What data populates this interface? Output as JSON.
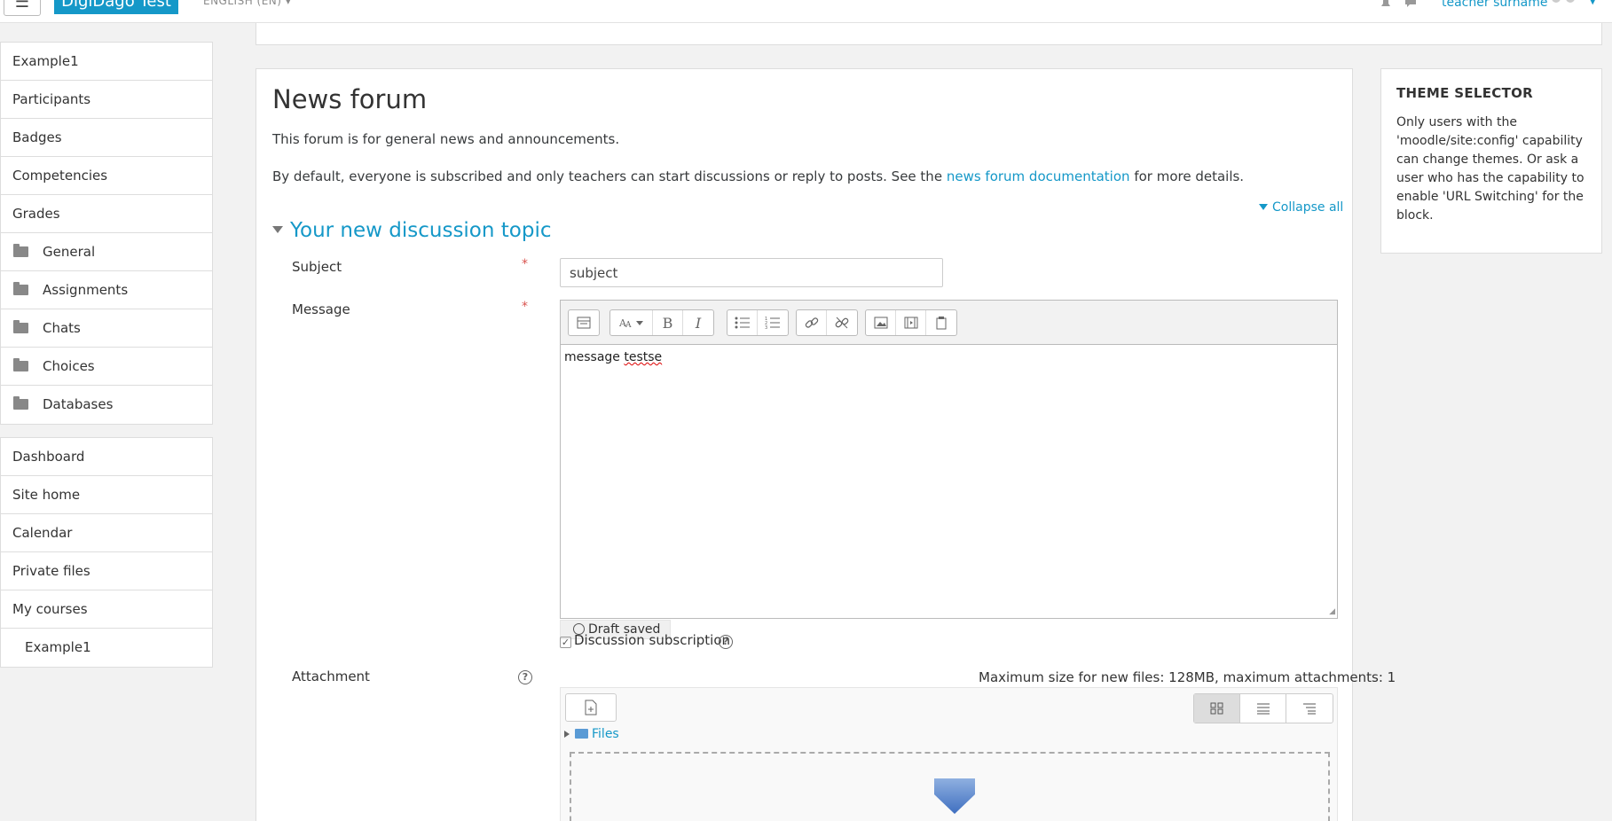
{
  "navbar": {
    "toggle_icon": "☰",
    "brand": "DigiDago Test",
    "language": "ENGLISH (EN)",
    "user_name": "teacher surname"
  },
  "sidebar": {
    "course_items": [
      {
        "label": "Example1",
        "type": "link"
      },
      {
        "label": "Participants",
        "type": "link"
      },
      {
        "label": "Badges",
        "type": "link"
      },
      {
        "label": "Competencies",
        "type": "link"
      },
      {
        "label": "Grades",
        "type": "link"
      },
      {
        "label": "General",
        "type": "folder"
      },
      {
        "label": "Assignments",
        "type": "folder"
      },
      {
        "label": "Chats",
        "type": "folder"
      },
      {
        "label": "Choices",
        "type": "folder"
      },
      {
        "label": "Databases",
        "type": "folder"
      }
    ],
    "site_items": [
      {
        "label": "Dashboard"
      },
      {
        "label": "Site home"
      },
      {
        "label": "Calendar"
      },
      {
        "label": "Private files"
      },
      {
        "label": "My courses"
      },
      {
        "label": "Example1"
      }
    ]
  },
  "main": {
    "title": "News forum",
    "intro": "This forum is for general news and announcements.",
    "intro2_before": "By default, everyone is subscribed and only teachers can start discussions or reply to posts. See the ",
    "intro2_link": "news forum documentation",
    "intro2_after": " for more details.",
    "collapse_all": "Collapse all",
    "section_title": "Your new discussion topic",
    "subject_label": "Subject",
    "subject_value": "subject",
    "required_mark": "*",
    "message_label": "Message",
    "message_word1": "message ",
    "message_word2": "testse",
    "draft_saved": "Draft saved",
    "subscription_label": "Discussion subscription",
    "attachment_label": "Attachment",
    "max_size": "Maximum size for new files: 128MB, maximum attachments: 1",
    "files_label": "Files"
  },
  "theme_selector": {
    "title": "THEME SELECTOR",
    "text": "Only users with the 'moodle/site:config' capability can change themes. Or ask a user who has the capability to enable 'URL Switching' for the block."
  },
  "colors": {
    "accent": "#1598c8",
    "required": "#d9534f",
    "background": "#f2f2f2"
  }
}
